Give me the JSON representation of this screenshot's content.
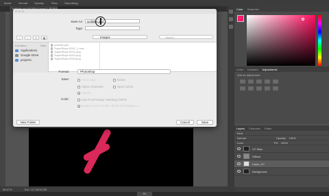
{
  "topbar": {
    "items": [
      "Mode:",
      "Normal",
      "Opacity:",
      "Flow:",
      "Smoothing:"
    ]
  },
  "document_tab": {
    "title": "scribble.psd @ 50% (Layer 1, RGB/8) *"
  },
  "status": {
    "zoom": "66.67%",
    "doc_size": "Doc: 12.1M/18.2M"
  },
  "dock": {
    "label": "Ps"
  },
  "panels": {
    "color": {
      "tabs": [
        "Color",
        "Swatches"
      ],
      "fg_color": "#ff1a6e",
      "bg_color": "#ffffff"
    },
    "adjustments": {
      "tabs": [
        "Learn",
        "Libraries",
        "Adjustments"
      ],
      "subtitle": "Add an adjustment"
    },
    "layers": {
      "tabs": [
        "Layers",
        "Channels",
        "Paths"
      ],
      "kind_filter": "Kind",
      "blend_mode": "Normal",
      "opacity_label": "Opacity:",
      "opacity": "100%",
      "lock_label": "Lock:",
      "fill_label": "Fill:",
      "fill": "100%",
      "layers": [
        {
          "name": "CC Map",
          "selected": false
        },
        {
          "name": "Diffuse",
          "selected": false
        },
        {
          "name": "Layer_CC",
          "selected": true
        },
        {
          "name": "Background",
          "selected": false
        }
      ]
    }
  },
  "dialog": {
    "save_as_label": "Save As:",
    "save_as_value": "scribble.psd",
    "tags_label": "Tags:",
    "tags_value": "",
    "location": "Images",
    "search_placeholder": "Search",
    "sidebar": {
      "header": "Favorites",
      "hide": "Hide",
      "items": [
        "Applications",
        "Google Drive",
        "projects"
      ]
    },
    "files": [
      "scribble.psd",
      "SuperSlope.0001_1.mov",
      "SuperSlope.0001.png",
      "SuperSlope.0002.png",
      "SuperSlope.0003.png"
    ],
    "format_label": "Format:",
    "format_value": "Photoshop",
    "save_label": "Save:",
    "options": {
      "as_a_copy": "As a Copy",
      "notes": "Notes",
      "alpha_channels": "Alpha Channels",
      "spot_colors": "Spot Colors",
      "layers": "Layers"
    },
    "color_label": "Color:",
    "use_proof_setup": "Use Proof Setup: Working CMYK",
    "embed_profile": "Embed Color Profile: sRGB IEC61966-2.1",
    "new_folder": "New Folder",
    "cancel": "Cancel",
    "save": "Save"
  }
}
